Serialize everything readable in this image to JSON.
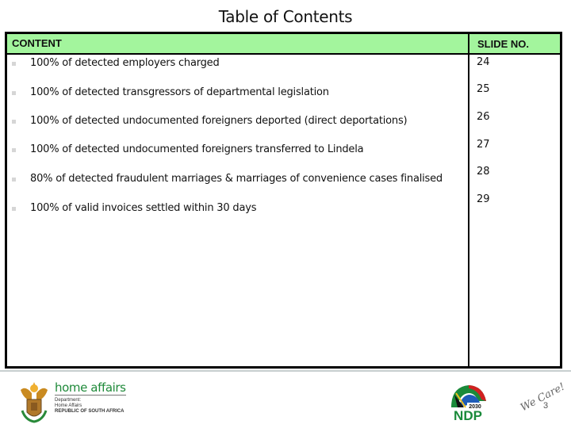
{
  "title": "Table of Contents",
  "table": {
    "header": {
      "content": "CONTENT",
      "slide_no": "SLIDE NO."
    },
    "rows": [
      {
        "text": "100%  of detected employers charged",
        "slide": "24"
      },
      {
        "text": "100% of detected transgressors of departmental legislation",
        "slide": "25"
      },
      {
        "text": "100%  of  detected undocumented foreigners deported (direct deportations)",
        "slide": "26"
      },
      {
        "text": "100% of detected undocumented foreigners  transferred  to Lindela",
        "slide": "27"
      },
      {
        "text": "80% of detected fraudulent marriages & marriages of convenience cases finalised",
        "slide": "28"
      },
      {
        "text": "100% of valid invoices settled within 30 days",
        "slide": "29"
      }
    ]
  },
  "footer": {
    "logo_left": {
      "icon": "coat-of-arms-icon",
      "name": "home affairs",
      "lines": [
        "Department:",
        "Home Affairs",
        "REPUBLIC OF SOUTH AFRICA"
      ]
    },
    "logo_ndp": {
      "icon": "ndp-2030-logo-icon",
      "year": "2030",
      "text": "NDP"
    },
    "slogan": "We Care!",
    "page_number": "3",
    "colors": {
      "header_green": "#a3f59d",
      "brand_green": "#1f8a3a"
    }
  }
}
